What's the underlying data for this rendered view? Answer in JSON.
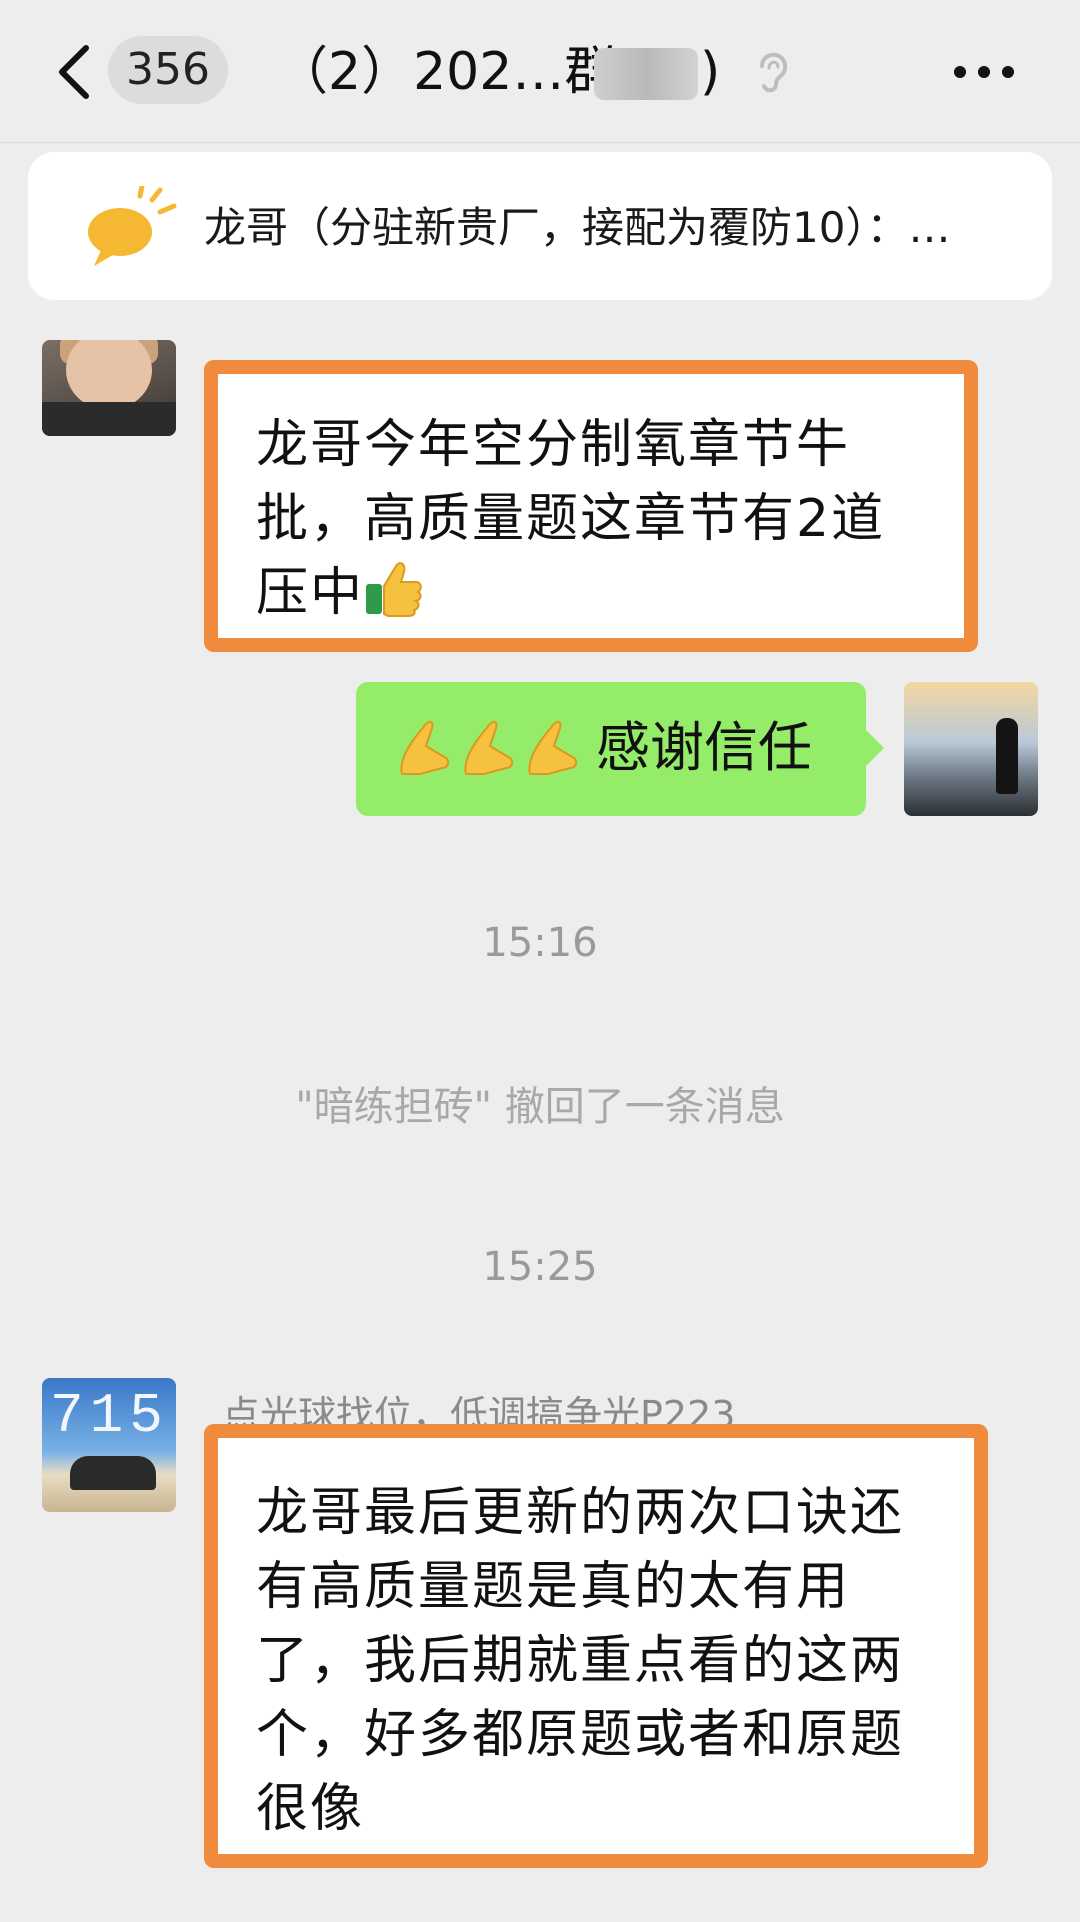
{
  "header": {
    "unread_count": "356",
    "title_visible": "（2）202…群(",
    "title_suffix": ")",
    "back_label": "back",
    "more_label": "more"
  },
  "notice": {
    "text": "龙哥（分驻新贵厂，接配为覆防10）：…",
    "icon": "announcement-icon"
  },
  "messages": [
    {
      "side": "left",
      "highlighted": true,
      "text_lines": [
        "龙哥今年空分制氧章节牛",
        "批，高质量题这章节有2道",
        "压中"
      ],
      "emoji": "thumbs-up-icon"
    },
    {
      "side": "right",
      "emoji": [
        "pray-hands-icon",
        "pray-hands-icon",
        "pray-hands-icon"
      ],
      "text": "感谢信任"
    }
  ],
  "timestamps": [
    "15:16",
    "15:25"
  ],
  "recall_notice": "\"暗练担砖\" 撤回了一条消息",
  "message3": {
    "sender": "点光球找位，低调搞争光P223",
    "avatar_text": "715",
    "text_lines": [
      "龙哥最后更新的两次口诀还",
      "有高质量题是真的太有用",
      "了，我后期就重点看的这两",
      "个，好多都原题或者和原题",
      "很像"
    ]
  },
  "colors": {
    "background": "#ededed",
    "highlight_border": "#f08a3c",
    "self_bubble": "#95ec69"
  }
}
